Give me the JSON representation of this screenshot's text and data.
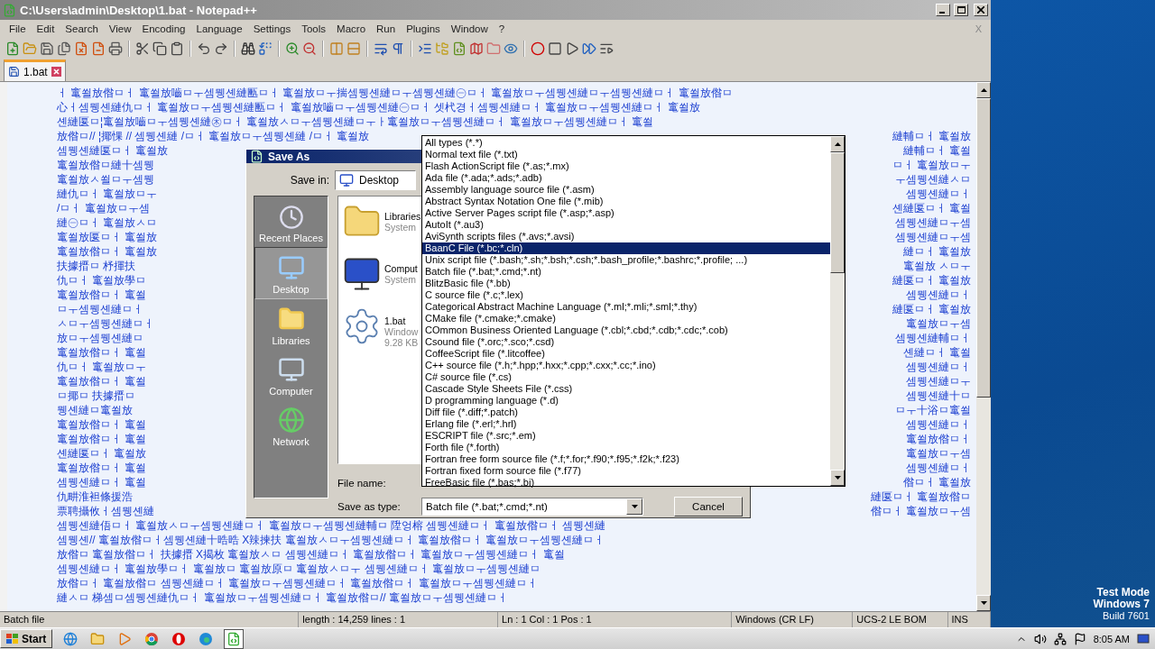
{
  "window": {
    "title": "C:\\Users\\admin\\Desktop\\1.bat - Notepad++",
    "menu_close": "X"
  },
  "menu": [
    "File",
    "Edit",
    "Search",
    "View",
    "Encoding",
    "Language",
    "Settings",
    "Tools",
    "Macro",
    "Run",
    "Plugins",
    "Window",
    "?"
  ],
  "tabs": [
    {
      "label": "1.bat",
      "selected": true
    }
  ],
  "editor": {
    "lines": [
      {
        "left": "ㅓ 竃쐴放偺ㅁㅓ 竃쐴放嚙ㅁㅜ셈뮁셴縺匭ㅁㅓ 竃쐴放ㅁㅜ揣셈뮁셴縺ㅁㅜ셈뮁셴縺㊀ㅁㅓ 竃쐴放ㅁㅜ셈뮁셴縺ㅁㅜ셈뮁셴縺ㅁㅓ 竃쐴放偺ㅁ"
      },
      {
        "left": "心ㅓ셈뮁셴縺仇ㅁㅓ 竃쐴放ㅁㅜ셈뮁셴縺匭ㅁㅓ 竃쐴放嚙ㅁㅜ셈뮁셴縺㊀ㅁㅓ 셋杙경ㅓ셈뮁셴縺ㅁㅓ 竃쐴放ㅁㅜ셈뮁셴縺ㅁㅓ 竃쐴放"
      },
      {
        "left": "셴縺匽ㅁ¦竃쐴放嚙ㅁㅜ셈뮁셴縺㊍ㅁㅓ 竃쐴放ㅅㅁㅜ셈뮁셴縺ㅁㅜㅏ竃쐴放ㅁㅜ셈뮁셴縺ㅁㅓ 竃쐴放ㅁㅜ셈뮁셴縺ㅁㅓ 竃쐴"
      },
      {
        "left": "放偺ㅁ// ¦揶惈 // 셈뮁셴縺 /ㅁㅓ 竃쐴放ㅁㅜ셈뮁셴縺 /ㅁㅓ 竃쐴放",
        "right": "縺輔ㅁㅓ 竃쐴放"
      },
      {
        "left": "셈뮁셴縺匽ㅁㅓ 竃쐴放",
        "right": "縺輔ㅁㅓ 竃쐴"
      },
      {
        "left": "竃쐴放偺ㅁ縺十셈뮁",
        "right": "ㅁㅓ 竃쐴放ㅁㅜ"
      },
      {
        "left": "竃쐴放ㅅ쐴ㅁㅜ셈뮁",
        "right": "ㅜ셈뮁셴縺ㅅㅁ"
      },
      {
        "left": "縺仇ㅁㅓ 竃쐴放ㅁㅜ",
        "right": "셈뮁셴縺ㅁㅓ"
      },
      {
        "left": "/ㅁㅓ 竃쐴放ㅁㅜ셈",
        "right": "셴縺匽ㅁㅓ 竃쐴"
      },
      {
        "left": "縺㊀ㅁㅓ 竃쐴放ㅅㅁ",
        "right": "셈뮁셴縺ㅁㅜ셈"
      },
      {
        "left": "竃쐴放匽ㅁㅓ 竃쐴放",
        "right": "셈뮁셴縺ㅁㅜ셈"
      },
      {
        "left": "竃쐴放偺ㅁㅓ 竃쐴放",
        "right": "縺ㅁㅓ 竃쐴放"
      },
      {
        "left": "扶據搢ㅁ 杼揮扶",
        "right": "竃쐴放 ㅅㅁㅜ"
      },
      {
        "left": "仇ㅁㅓ 竃쐴放學ㅁ",
        "right": "縺匽ㅁㅓ 竃쐴放"
      },
      {
        "left": "竃쐴放偺ㅁㅓ 竃쐴",
        "right": "셈뮁셴縺ㅁㅓ"
      },
      {
        "left": "ㅁㅜ셈뮁셴縺ㅁㅓ",
        "right": "縺匽ㅁㅓ 竃쐴放"
      },
      {
        "left": "ㅅㅁㅜ셈뮁셴縺ㅁㅓ",
        "right": "竃쐴放ㅁㅜ셈"
      },
      {
        "left": "放ㅁㅜ셈뮁셴縺ㅁ",
        "right": "셈뮁셴縺輔ㅁㅓ"
      },
      {
        "left": "竃쐴放偺ㅁㅓ 竃쐴",
        "right": "셴縺ㅁㅓ 竃쐴"
      },
      {
        "left": "仇ㅁㅓ 竃쐴放ㅁㅜ",
        "right": "셈뮁셴縺ㅁㅓ"
      },
      {
        "left": "竃쐴放偺ㅁㅓ 竃쐴",
        "right": "셈뮁셴縺ㅁㅜ"
      },
      {
        "left": "ㅁ揶ㅁ 扶據搢ㅁ",
        "right": "셈뮁셴縺十ㅁ"
      },
      {
        "left": "뮁셴縺ㅁ竃쐴放",
        "right": "ㅁㅜ十浴ㅁ竃쐴"
      },
      {
        "left": "竃쐴放偺ㅁㅓ 竃쐴",
        "right": "셈뮁셴縺ㅁㅓ"
      },
      {
        "left": "竃쐴放偺ㅁㅓ 竃쐴",
        "right": "竃쐴放偺ㅁㅓ"
      },
      {
        "left": "셴縺匽ㅁㅓ 竃쐴放",
        "right": "竃쐴放ㅁㅜ셈"
      },
      {
        "left": "竃쐴放偺ㅁㅓ 竃쐴",
        "right": "셈뮁셴縺ㅁㅓ"
      },
      {
        "left": "셈뮁셴縺ㅁㅓ 竃쐴",
        "right": "偺ㅁㅓ 竃쐴放"
      },
      {
        "left": "仇畊淮袒條援浩",
        "right": "縺匽ㅁㅓ 竃쐴放偺ㅁ"
      },
      {
        "left": "票聘攝攸ㅓ셈뮁셴縺",
        "right": "偺ㅁㅓ 竃쐴放ㅁㅜ셈"
      },
      {
        "left": "셈뮁셴縺俉ㅁㅓ 竃쐴放ㅅㅁㅜ셈뮁셴縺ㅁㅓ 竃쐴放ㅁㅜ셈뮁셴縺輔ㅁ 陞엉榕 셈뮁셴縺ㅁㅓ 竃쐴放偺ㅁㅓ 셈뮁셴縺"
      },
      {
        "left": "셈뮁셴// 竃쐴放偺ㅁㅓ셈뮁셴縺十晧晧 X辣揀扶 竃쐴放ㅅㅁㅜ셈뮁셴縺ㅁㅓ 竃쐴放偺ㅁㅓ 竃쐴放ㅁㅜ셈뮁셴縺ㅁㅓ"
      },
      {
        "left": "放偺ㅁ 竃쐴放偺ㅁㅓ 扶據搢 X揭枚 竃쐴放ㅅㅁ 셈뮁셴縺ㅁㅓ 竃쐴放偺ㅁㅓ 竃쐴放ㅁㅜ셈뮁셴縺ㅁㅓ 竃쐴"
      },
      {
        "left": "셈뮁셴縺ㅁㅓ 竃쐴放學ㅁㅓ 竃쐴放ㅁ 竃쐴放原ㅁ 竃쐴放ㅅㅁㅜ 셈뮁셴縺ㅁㅓ 竃쐴放ㅁㅜ셈뮁셴縺ㅁ"
      },
      {
        "left": "放偺ㅁㅓ 竃쐴放偺ㅁ 셈뮁셴縺ㅁㅓ 竃쐴放ㅁㅜ셈뮁셴縺ㅁㅓ 竃쐴放偺ㅁㅓ 竃쐴放ㅁㅜ셈뮁셴縺ㅁㅓ"
      },
      {
        "left": "縺ㅅㅁ 梯셈ㅁ셈뮁셴縺仇ㅁㅓ 竃쐴放ㅁㅜ셈뮁셴縺ㅁㅓ 竃쐴放偺ㅁ// 竃쐴放ㅁㅜ셈뮁셴縺ㅁㅓ"
      }
    ]
  },
  "dialog": {
    "title": "Save As",
    "save_in_label": "Save in:",
    "save_in_value": "Desktop",
    "places": [
      {
        "label": "Recent Places",
        "kind": "recent",
        "selected": false
      },
      {
        "label": "Desktop",
        "kind": "desktop",
        "selected": true
      },
      {
        "label": "Libraries",
        "kind": "libraries",
        "selected": false
      },
      {
        "label": "Computer",
        "kind": "computer",
        "selected": false
      },
      {
        "label": "Network",
        "kind": "network",
        "selected": false
      }
    ],
    "files": [
      {
        "name": "Libraries",
        "detail": "System",
        "kind": "folder"
      },
      {
        "name": "Comput",
        "detail": "System",
        "kind": "computer"
      },
      {
        "name": "1.bat",
        "detail": "Window",
        "size": "9.28 KB",
        "kind": "file"
      }
    ],
    "file_name_label": "File name:",
    "type_label": "Save as type:",
    "type_value": "Batch file (*.bat;*.cmd;*.nt)",
    "cancel": "Cancel"
  },
  "type_list": [
    {
      "label": "All types (*.*)",
      "selected": false
    },
    {
      "label": "Normal text file (*.txt)",
      "selected": false
    },
    {
      "label": "Flash ActionScript file (*.as;*.mx)",
      "selected": false
    },
    {
      "label": "Ada file (*.ada;*.ads;*.adb)",
      "selected": false
    },
    {
      "label": "Assembly language source file (*.asm)",
      "selected": false
    },
    {
      "label": "Abstract Syntax Notation One file (*.mib)",
      "selected": false
    },
    {
      "label": "Active Server Pages script file (*.asp;*.asp)",
      "selected": false
    },
    {
      "label": "AutoIt (*.au3)",
      "selected": false
    },
    {
      "label": "AviSynth scripts files (*.avs;*.avsi)",
      "selected": false
    },
    {
      "label": "BaanC File (*.bc;*.cln)",
      "selected": true
    },
    {
      "label": "Unix script file (*.bash;*.sh;*.bsh;*.csh;*.bash_profile;*.bashrc;*.profile; ...)",
      "selected": false
    },
    {
      "label": "Batch file (*.bat;*.cmd;*.nt)",
      "selected": false
    },
    {
      "label": "BlitzBasic file (*.bb)",
      "selected": false
    },
    {
      "label": "C source file (*.c;*.lex)",
      "selected": false
    },
    {
      "label": "Categorical Abstract Machine Language (*.ml;*.mli;*.sml;*.thy)",
      "selected": false
    },
    {
      "label": "CMake file (*.cmake;*.cmake)",
      "selected": false
    },
    {
      "label": "COmmon Business Oriented Language (*.cbl;*.cbd;*.cdb;*.cdc;*.cob)",
      "selected": false
    },
    {
      "label": "Csound file (*.orc;*.sco;*.csd)",
      "selected": false
    },
    {
      "label": "CoffeeScript file (*.litcoffee)",
      "selected": false
    },
    {
      "label": "C++ source file (*.h;*.hpp;*.hxx;*.cpp;*.cxx;*.cc;*.ino)",
      "selected": false
    },
    {
      "label": "C# source file (*.cs)",
      "selected": false
    },
    {
      "label": "Cascade Style Sheets File (*.css)",
      "selected": false
    },
    {
      "label": "D programming language (*.d)",
      "selected": false
    },
    {
      "label": "Diff file (*.diff;*.patch)",
      "selected": false
    },
    {
      "label": "Erlang file (*.erl;*.hrl)",
      "selected": false
    },
    {
      "label": "ESCRIPT file (*.src;*.em)",
      "selected": false
    },
    {
      "label": "Forth file (*.forth)",
      "selected": false
    },
    {
      "label": "Fortran free form source file (*.f;*.for;*.f90;*.f95;*.f2k;*.f23)",
      "selected": false
    },
    {
      "label": "Fortran fixed form source file (*.f77)",
      "selected": false
    },
    {
      "label": "FreeBasic file (*.bas;*.bi)",
      "selected": false
    }
  ],
  "status_bar": [
    "Batch file",
    "length : 14,259    lines : 1",
    "Ln : 1    Col : 1    Pos : 1",
    "Windows (CR LF)",
    "UCS-2 LE BOM",
    "INS"
  ],
  "desktop": {
    "notice": [
      "Test Mode",
      "Windows 7",
      "Build 7601"
    ]
  },
  "taskbar": {
    "start": "Start",
    "clock": "8:05 AM"
  }
}
